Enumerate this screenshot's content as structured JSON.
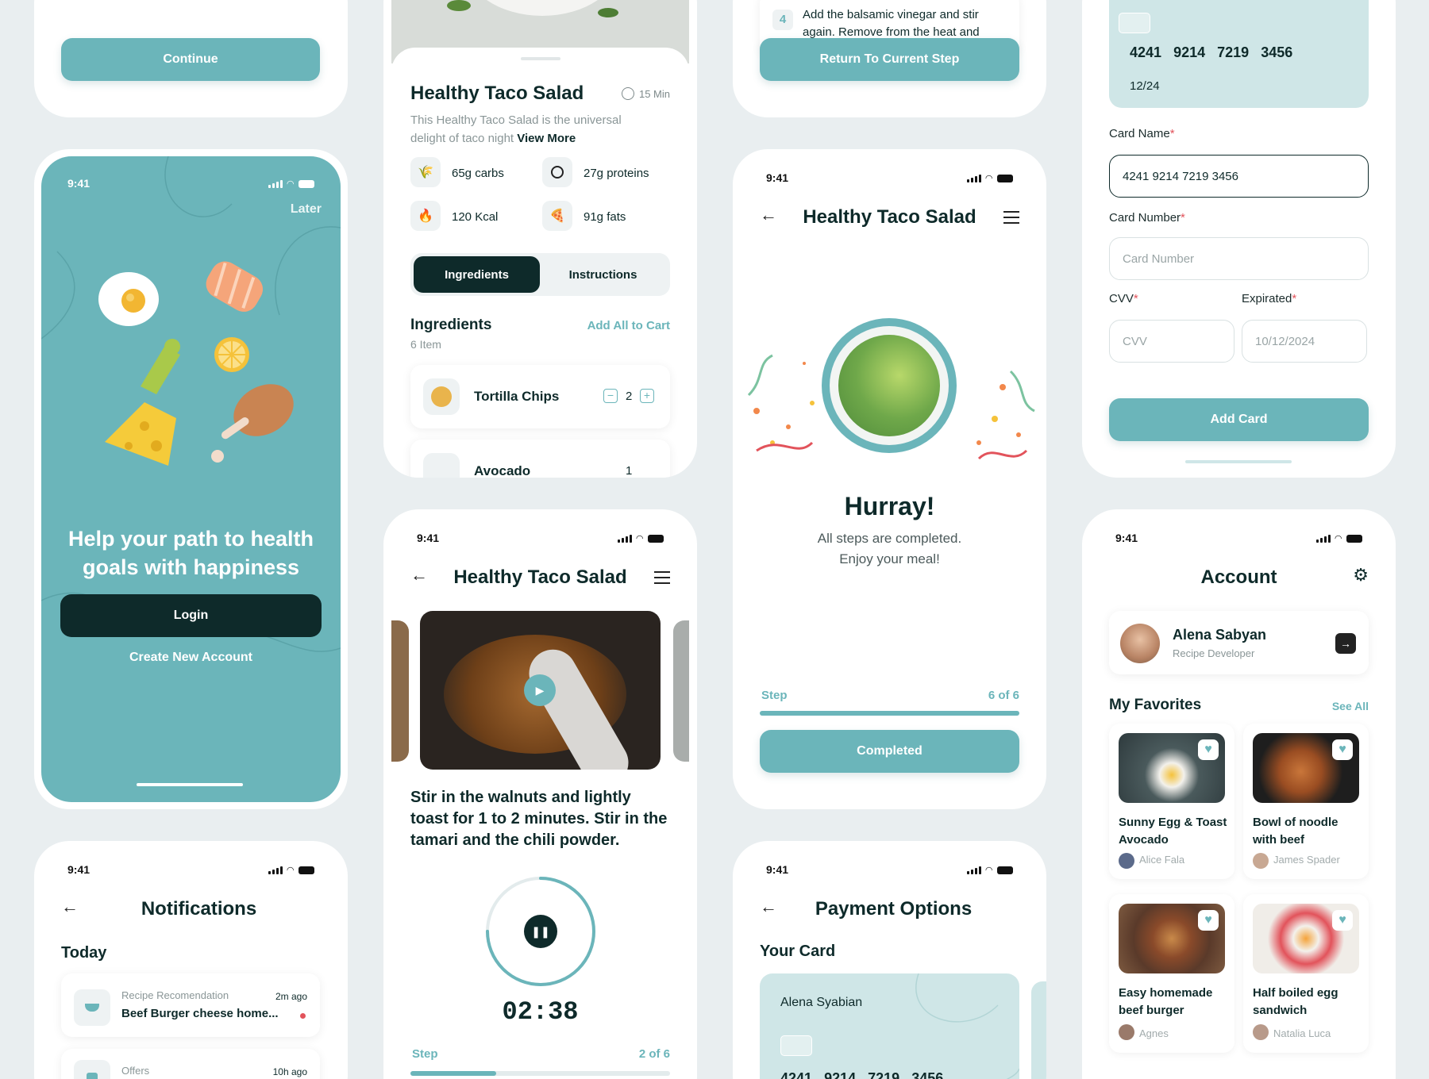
{
  "status_time": "9:41",
  "continue_card": {
    "button": "Continue"
  },
  "onboarding": {
    "later": "Later",
    "headline": "Help your path to health goals with happiness",
    "login": "Login",
    "create_account": "Create New Account"
  },
  "notifications": {
    "title": "Notifications",
    "section": "Today",
    "items": [
      {
        "category": "Recipe Recomendation",
        "time": "2m ago",
        "text": "Beef Burger cheese home..."
      },
      {
        "category": "Offers",
        "time": "10h ago",
        "text": ""
      }
    ]
  },
  "recipe_detail": {
    "title": "Healthy Taco Salad",
    "time": "15 Min",
    "description": "This Healthy Taco Salad is the universal delight of taco night",
    "view_more": "View More",
    "nutrition": [
      {
        "icon": "wheat-icon",
        "label": "65g carbs"
      },
      {
        "icon": "protein-icon",
        "label": "27g proteins"
      },
      {
        "icon": "flame-icon",
        "label": "120 Kcal"
      },
      {
        "icon": "pizza-icon",
        "label": "91g fats"
      }
    ],
    "tabs": [
      "Ingredients",
      "Instructions"
    ],
    "ingredients_title": "Ingredients",
    "ingredients_count": "6 Item",
    "add_all": "Add All to Cart",
    "ingredients": [
      {
        "name": "Tortilla Chips",
        "qty": "2"
      },
      {
        "name": "Avocado",
        "qty": "1"
      }
    ]
  },
  "cooking_step": {
    "title": "Healthy Taco Salad",
    "instruction": "Stir in the walnuts and lightly toast for 1 to 2 minutes. Stir in the tamari and the chili powder.",
    "timer": "02:38",
    "timer_progress": 0.75,
    "step_label": "Step",
    "step_value": "2 of 6",
    "step_progress": 0.33
  },
  "step_four": {
    "number": "4",
    "text": "Add the balsamic vinegar and stir again. Remove from the heat and",
    "button": "Return To Current Step"
  },
  "completed": {
    "title": "Healthy Taco Salad",
    "headline": "Hurray!",
    "line1": "All steps are completed.",
    "line2": "Enjoy your meal!",
    "step_label": "Step",
    "step_value": "6 of 6",
    "step_progress": 1,
    "button": "Completed"
  },
  "payment": {
    "title": "Payment Options",
    "section": "Your Card",
    "card_holder": "Alena Syabian",
    "card_number": [
      "4241",
      "9214",
      "7219",
      "3456"
    ]
  },
  "add_card": {
    "card_number": [
      "4241",
      "9214",
      "7219",
      "3456"
    ],
    "card_expiry": "12/24",
    "card_name_label": "Card Name",
    "card_name_value": "4241 9214 7219 3456",
    "card_number_label": "Card Number",
    "card_number_placeholder": "Card Number",
    "cvv_label": "CVV",
    "cvv_placeholder": "CVV",
    "expired_label": "Expirated",
    "expired_placeholder": "10/12/2024",
    "required_mark": "*",
    "button": "Add Card"
  },
  "account": {
    "title": "Account",
    "name": "Alena Sabyan",
    "role": "Recipe Developer",
    "favorites_title": "My Favorites",
    "see_all": "See All",
    "favorites": [
      {
        "title": "Sunny Egg & Toast Avocado",
        "author": "Alice Fala"
      },
      {
        "title": "Bowl of noodle with beef",
        "author": "James Spader"
      },
      {
        "title": "Easy homemade beef burger",
        "author": "Agnes"
      },
      {
        "title": "Half boiled egg sandwich",
        "author": "Natalia Luca"
      }
    ]
  },
  "colors": {
    "accent": "#6bb5ba",
    "dark": "#0e2a2a",
    "mint": "#cfe6e7",
    "alert": "#e2535b"
  }
}
